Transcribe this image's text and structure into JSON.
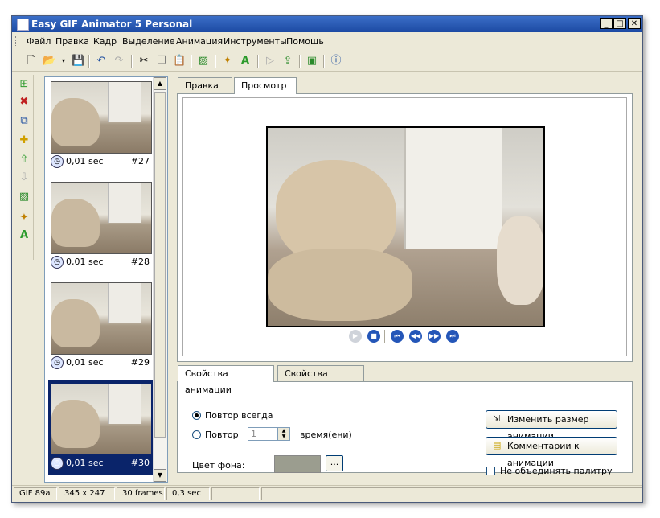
{
  "window": {
    "title": "Easy GIF Animator 5 Personal",
    "buttons": [
      "_",
      "□",
      "✕"
    ]
  },
  "menu": [
    "Файл",
    "Правка",
    "Кадр",
    "Выделение",
    "Анимация",
    "Инструменты",
    "Помощь"
  ],
  "toolbar_icons": [
    "new-icon",
    "open-icon",
    "dropdown-icon",
    "save-icon",
    "undo-icon",
    "redo-icon",
    "cut-icon",
    "copy-icon",
    "paste-icon",
    "edit-image-icon",
    "magic-wand-icon",
    "text-icon",
    "play-icon",
    "export-icon",
    "resize-icon",
    "help-icon"
  ],
  "side_tools": [
    "add-frame-icon",
    "delete-frame-icon",
    "duplicate-frame-icon",
    "insert-frame-icon",
    "move-up-icon",
    "move-down-icon",
    "edit-frame-icon",
    "wand-icon",
    "text-icon"
  ],
  "frames": [
    {
      "time": "0,01 sec",
      "number": "#27"
    },
    {
      "time": "0,01 sec",
      "number": "#28"
    },
    {
      "time": "0,01 sec",
      "number": "#29"
    },
    {
      "time": "0,01 sec",
      "number": "#30"
    }
  ],
  "tabs_top": [
    "Правка",
    "Просмотр"
  ],
  "tabs_bottom": [
    "Свойства анимации",
    "Свойства кадра"
  ],
  "props": {
    "repeat_always": "Повтор всегда",
    "repeat": "Повтор",
    "repeat_value": "1",
    "repeat_suffix": "время(ени)",
    "bg_color_label": "Цвет фона:",
    "bg_color": "#9b9d8f",
    "ellipsis": "...",
    "resize_button": "Изменить размер анимации",
    "comments_button": "Комментарии к анимации",
    "no_merge_palette": "Не объединять палитру"
  },
  "status": {
    "format": "GIF 89a",
    "size": "345 x 247",
    "frames": "30 frames",
    "duration": "0,3 sec"
  }
}
